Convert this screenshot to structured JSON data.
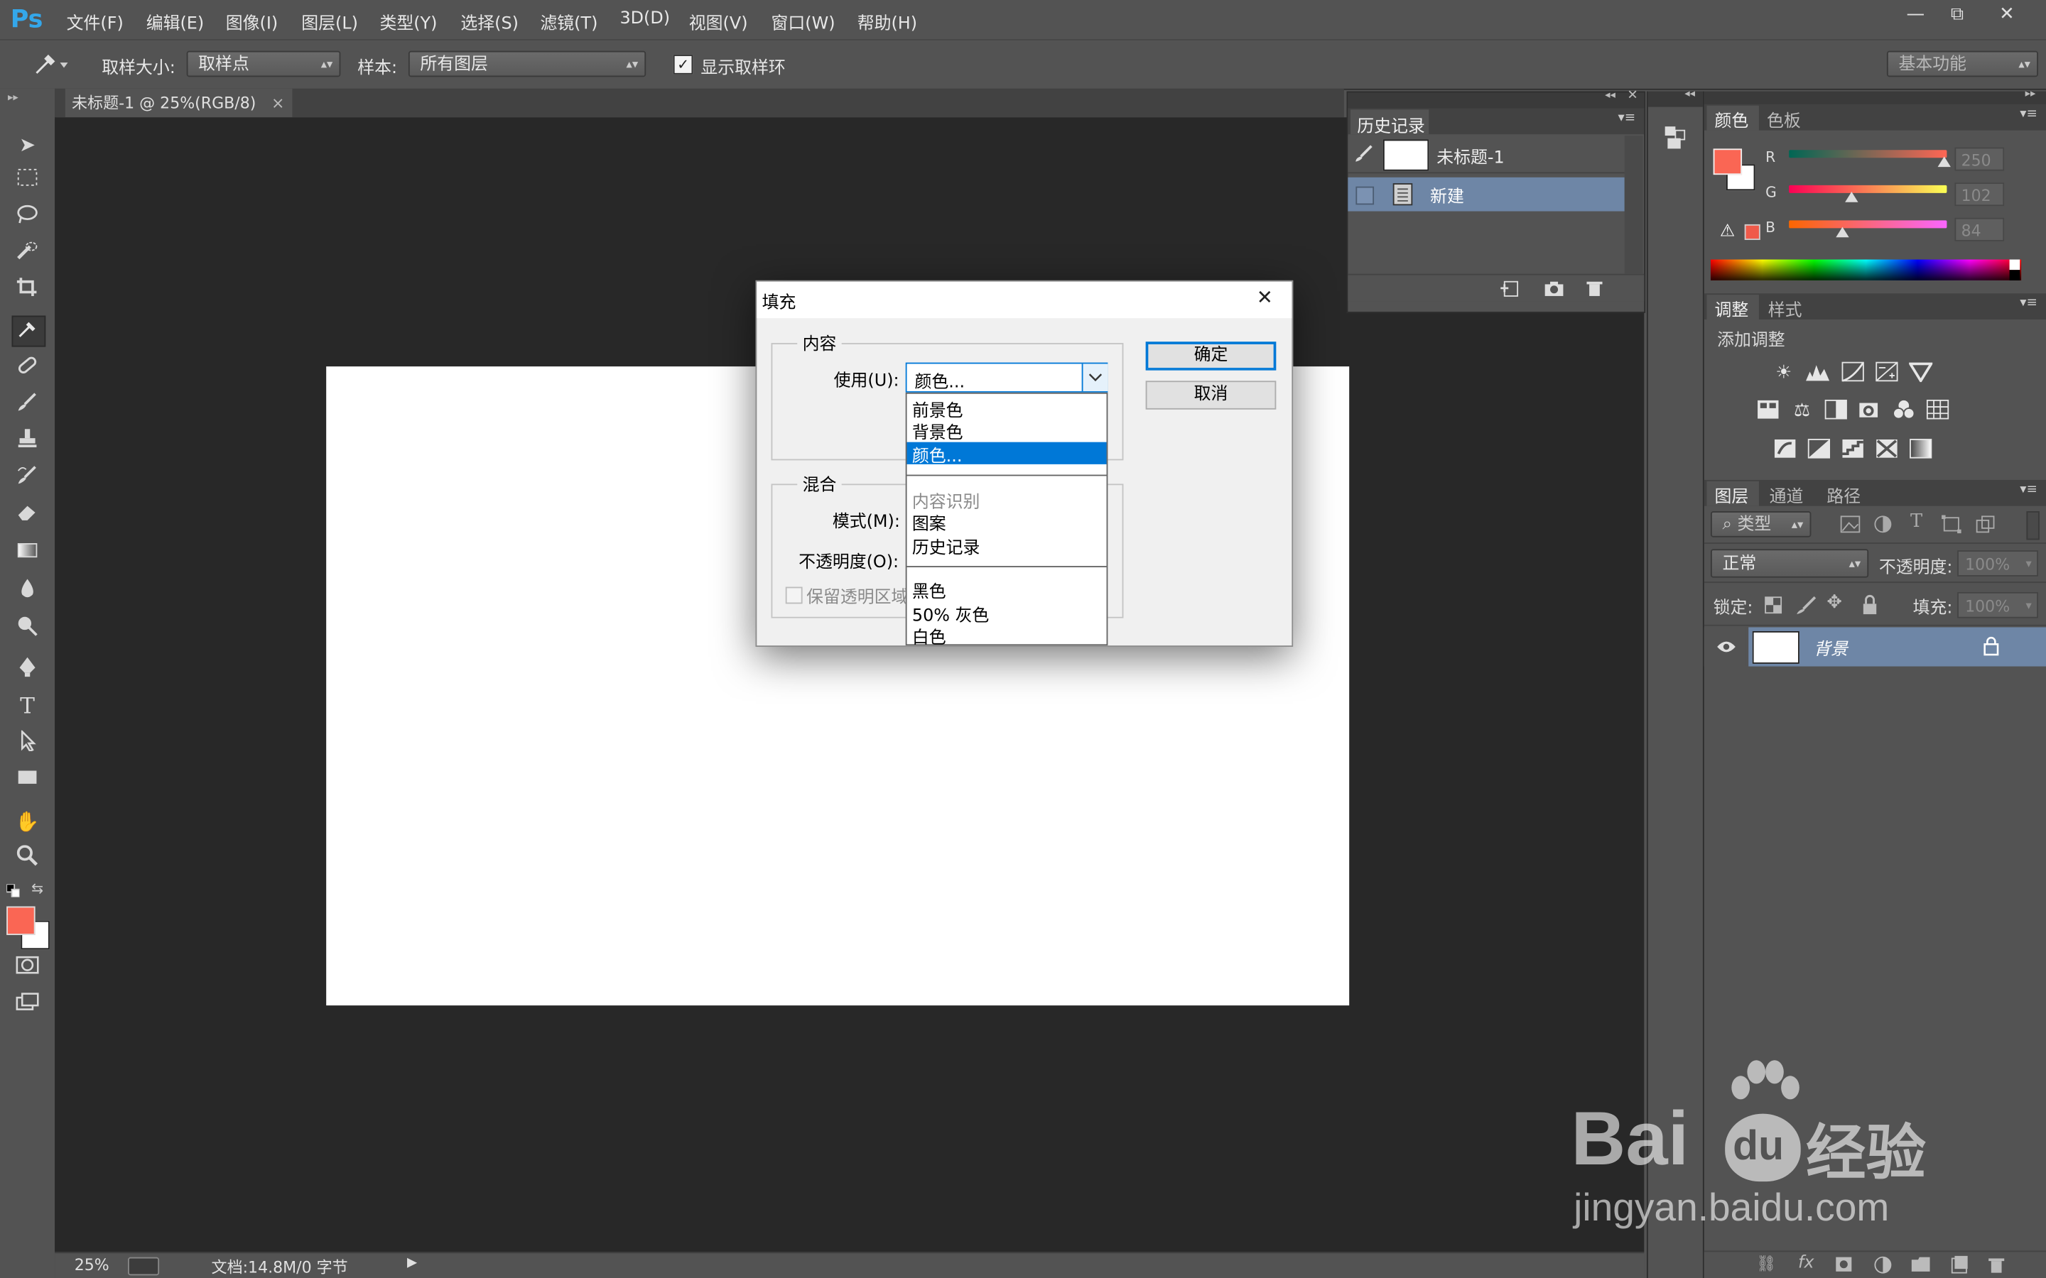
{
  "app": {
    "logo": "Ps"
  },
  "menubar": {
    "items": [
      "文件(F)",
      "编辑(E)",
      "图像(I)",
      "图层(L)",
      "类型(Y)",
      "选择(S)",
      "滤镜(T)",
      "3D(D)",
      "视图(V)",
      "窗口(W)",
      "帮助(H)"
    ],
    "window_controls": [
      "—",
      "⧉",
      "✕"
    ]
  },
  "optionsbar": {
    "sample_size_label": "取样大小:",
    "sample_size_value": "取样点",
    "sample_label": "样本:",
    "sample_value": "所有图层",
    "show_ring_label": "显示取样环",
    "workspace_value": "基本功能"
  },
  "document": {
    "tab_title": "未标题-1 @ 25%(RGB/8)",
    "tab_close": "×"
  },
  "statusbar": {
    "zoom": "25%",
    "doc_info": "文档:14.8M/0 字节"
  },
  "history": {
    "tab": "历史记录",
    "snapshot_name": "未标题-1",
    "state_name": "新建"
  },
  "color_panel": {
    "tabs": [
      "颜色",
      "色板"
    ],
    "r_label": "R",
    "g_label": "G",
    "b_label": "B",
    "r_value": "250",
    "g_value": "102",
    "b_value": "84",
    "foreground": "#fa6654",
    "background": "#ffffff"
  },
  "adjustments_panel": {
    "tabs": [
      "调整",
      "样式"
    ],
    "add_label": "添加调整"
  },
  "layers_panel": {
    "tabs": [
      "图层",
      "通道",
      "路径"
    ],
    "filter_kind": "类型",
    "blend_mode": "正常",
    "opacity_label": "不透明度:",
    "opacity_value": "100%",
    "lock_label": "锁定:",
    "fill_label": "填充:",
    "fill_value": "100%",
    "layer_name": "背景"
  },
  "fill_dialog": {
    "title": "填充",
    "close": "✕",
    "content_group": "内容",
    "use_label": "使用(U):",
    "use_value": "颜色...",
    "blend_group": "混合",
    "mode_label": "模式(M):",
    "opacity_label": "不透明度(O):",
    "preserve_label": "保留透明区域",
    "ok": "确定",
    "cancel": "取消",
    "options": [
      "前景色",
      "背景色",
      "颜色...",
      "内容识别",
      "图案",
      "历史记录",
      "黑色",
      "50% 灰色",
      "白色"
    ],
    "selected_option": "颜色..."
  },
  "watermark": {
    "brand": "Bai",
    "brand2": "du",
    "cn": "经验",
    "url": "jingyan.baidu.com"
  }
}
